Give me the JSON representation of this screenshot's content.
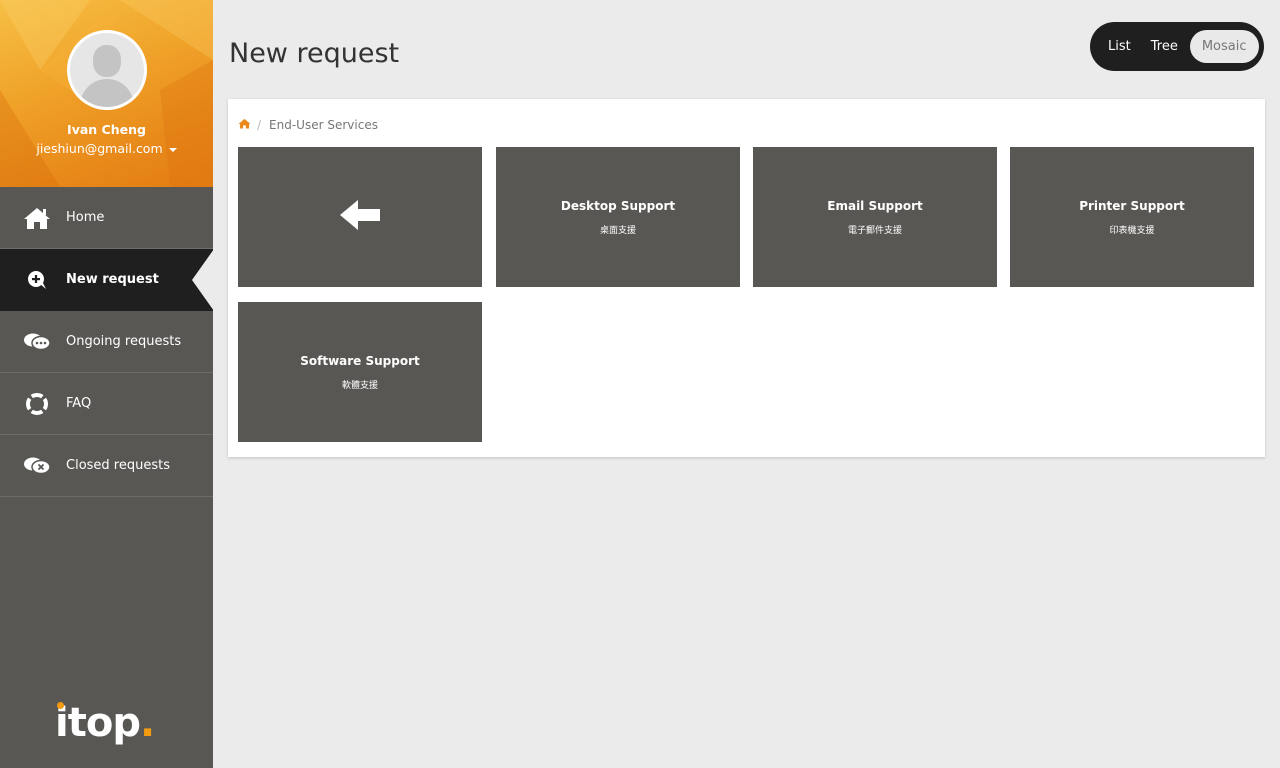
{
  "user": {
    "name": "Ivan Cheng",
    "email": "jieshiun@gmail.com"
  },
  "nav": {
    "items": [
      {
        "label": "Home",
        "icon": "home-icon"
      },
      {
        "label": "New request",
        "icon": "new-request-icon",
        "active": true
      },
      {
        "label": "Ongoing requests",
        "icon": "ongoing-requests-icon"
      },
      {
        "label": "FAQ",
        "icon": "faq-lifebuoy-icon"
      },
      {
        "label": "Closed requests",
        "icon": "closed-requests-icon"
      }
    ]
  },
  "logo": {
    "text": "itop"
  },
  "page": {
    "title": "New request"
  },
  "view_toggle": {
    "options": [
      "List",
      "Tree",
      "Mosaic"
    ],
    "selected": "Mosaic"
  },
  "breadcrumb": {
    "home_icon": "home-icon",
    "current": "End-User Services"
  },
  "tiles": [
    {
      "type": "back",
      "icon": "back-arrow-icon"
    },
    {
      "title": "Desktop Support",
      "subtitle": "桌面支援"
    },
    {
      "title": "Email Support",
      "subtitle": "電子郵件支援"
    },
    {
      "title": "Printer Support",
      "subtitle": "印表機支援"
    },
    {
      "title": "Software Support",
      "subtitle": "軟體支援"
    }
  ],
  "colors": {
    "accent": "#e8891a",
    "sidebar": "#595754",
    "active": "#1f1f1f",
    "tile": "#595754"
  }
}
